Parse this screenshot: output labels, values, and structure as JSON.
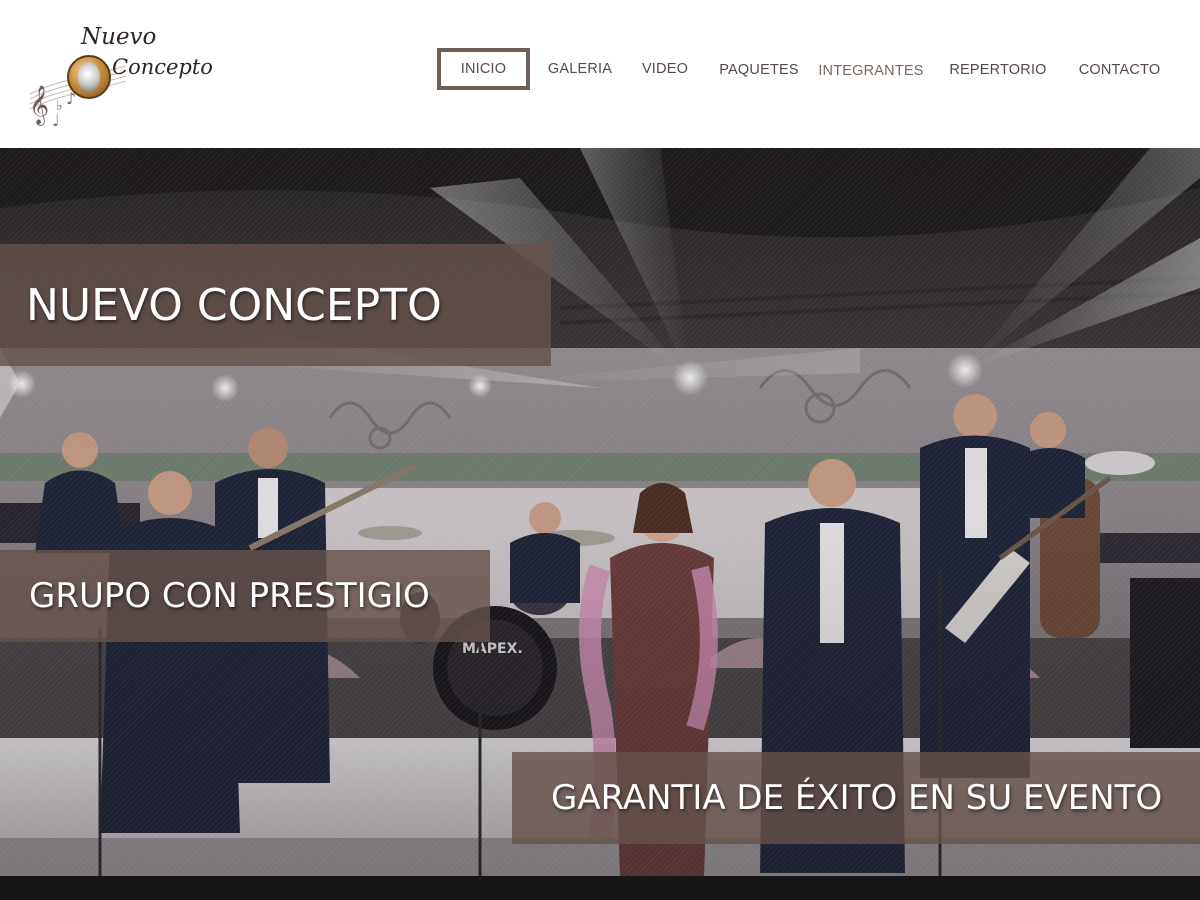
{
  "logo": {
    "line1": "Nuevo",
    "line2": "Concepto"
  },
  "nav": {
    "items": [
      {
        "label": "INICIO",
        "active": true
      },
      {
        "label": "GALERIA",
        "active": false
      },
      {
        "label": "VIDEO",
        "active": false
      },
      {
        "label": "PAQUETES",
        "active": false
      },
      {
        "label": "INTEGRANTES",
        "active": false
      },
      {
        "label": "REPERTORIO",
        "active": false
      },
      {
        "label": "CONTACTO",
        "active": false
      }
    ]
  },
  "hero": {
    "headline": "NUEVO CONCEPTO",
    "subline": "GRUPO CON PRESTIGIO",
    "tagline": "GARANTIA DE ÉXITO EN SU EVENTO",
    "drum_brand": "MAPEX."
  },
  "colors": {
    "banner_bg": "#65524a",
    "nav_text": "#554a46",
    "nav_active_border": "#6e5f58",
    "footer": "#171616"
  }
}
